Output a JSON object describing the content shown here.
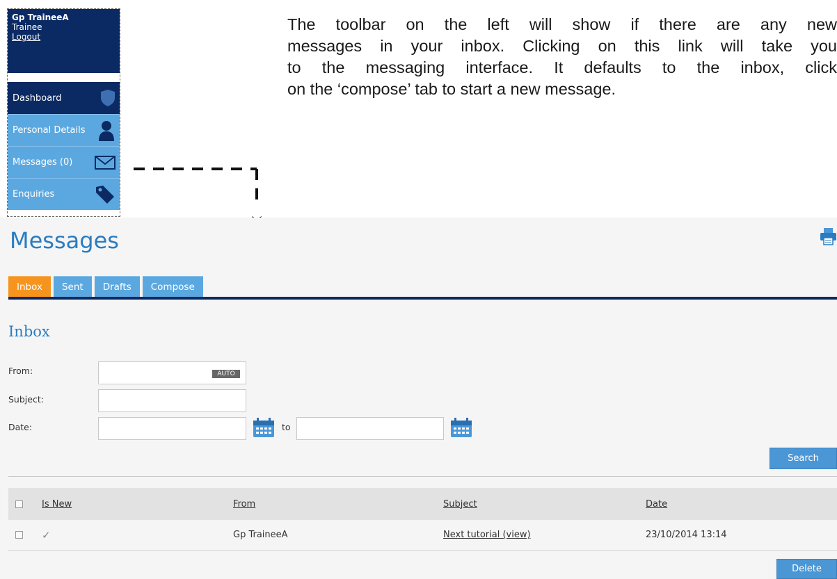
{
  "user": {
    "name": "Gp TraineeA",
    "role": "Trainee",
    "logout": "Logout"
  },
  "sidebar": {
    "items": [
      {
        "label": "Dashboard",
        "icon": "shield-icon"
      },
      {
        "label": "Personal Details",
        "icon": "person-icon"
      },
      {
        "label": "Messages (0)",
        "icon": "envelope-icon"
      },
      {
        "label": "Enquiries",
        "icon": "tag-icon"
      }
    ]
  },
  "description": [
    "The toolbar on the left will show if there are any new",
    "messages in your inbox. Clicking on this link will take you",
    "to the messaging interface. It defaults to the inbox, click",
    "on the ‘compose’ tab to start a new message."
  ],
  "page": {
    "title": "Messages"
  },
  "tabs": [
    {
      "label": "Inbox",
      "active": true
    },
    {
      "label": "Sent"
    },
    {
      "label": "Drafts"
    },
    {
      "label": "Compose"
    }
  ],
  "inbox": {
    "title": "Inbox",
    "from_label": "From:",
    "auto_badge": "AUTO",
    "subject_label": "Subject:",
    "date_label": "Date:",
    "to_label": "to",
    "search_button": "Search",
    "delete_button": "Delete"
  },
  "table": {
    "headers": {
      "is_new": "Is New",
      "from": "From",
      "subject": "Subject",
      "date": "Date"
    },
    "rows": [
      {
        "is_new": "✓",
        "from": "Gp TraineeA",
        "subject": "Next tutorial (view)",
        "date": "23/10/2014 13:14"
      }
    ]
  },
  "colors": {
    "navy": "#0b2a63",
    "light_blue": "#5ba8e0",
    "title_blue": "#2a7cc0",
    "active_tab": "#f7941e",
    "button": "#4b97d6"
  }
}
